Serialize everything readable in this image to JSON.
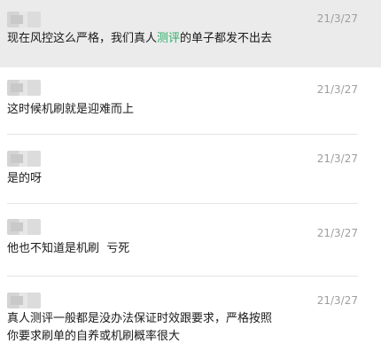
{
  "comments": [
    {
      "time": "21/3/27",
      "text_before": "现在风控这么严格，我们真人",
      "highlight": "测评",
      "text_after": "的单子都发不出去"
    },
    {
      "time": "21/3/27",
      "text": "这时候机刷就是迎难而上"
    },
    {
      "time": "21/3/27",
      "text": "是的呀"
    },
    {
      "time": "21/3/27",
      "text": "他也不知道是机刷  亏死"
    },
    {
      "time": "21/3/27",
      "text": "真人测评一般都是没办法保证时效跟要求，严格按照\n你要求刷单的自养或机刷概率很大"
    }
  ],
  "colors": {
    "highlight_row": "#ebebeb",
    "link": "#2aae67",
    "timestamp": "#9e9e9e"
  }
}
